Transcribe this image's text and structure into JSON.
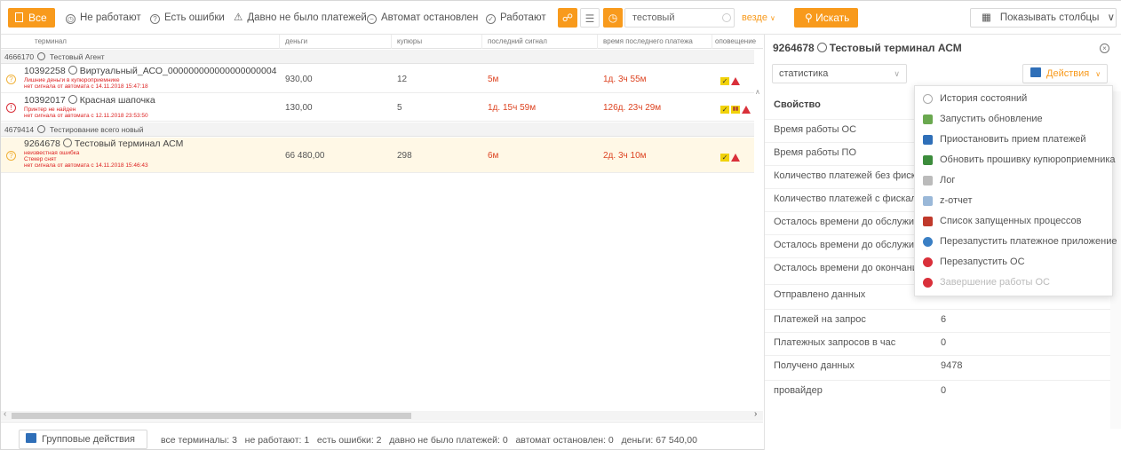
{
  "toolbar": {
    "filter_all": "Все",
    "filter_not_working": "Не работают",
    "filter_errors": "Есть ошибки",
    "filter_no_payments": "Давно не было платежей",
    "filter_stopped": "Автомат остановлен",
    "filter_working": "Работают",
    "search_value": "тестовый",
    "scope": "везде",
    "search_button": "Искать",
    "columns_button": "Показывать столбцы",
    "accent": "#f89a1c"
  },
  "table": {
    "headers": [
      "терминал",
      "деньги",
      "купюры",
      "последний сигнал",
      "время последнего платежа",
      "оповещение"
    ],
    "groups": [
      {
        "label": "4666170",
        "name": "Тестовый Агент"
      },
      {
        "label": "4679414",
        "name": "Тестирование всего новый"
      }
    ],
    "rows": [
      {
        "id": "10392258",
        "name": "Виртуальный_АСО_000000000000000000004",
        "errors": [
          "Лишние деньги в купюроприемнике",
          "нет сигнала от автомата с 14.11.2018 15:47:18"
        ],
        "money": "930,00",
        "bills": "12",
        "last_signal": "5м",
        "last_payment": "1д. 3ч 55м",
        "status": "warn"
      },
      {
        "id": "10392017",
        "name": "Красная шапочка",
        "errors": [
          "Принтер не найден",
          "нет сигнала от автомата с 12.11.2018 23:53:50"
        ],
        "money": "130,00",
        "bills": "5",
        "last_signal": "1д. 15ч 59м",
        "last_payment": "126д. 23ч 29м",
        "status": "err"
      },
      {
        "id": "9264678",
        "name": "Тестовый терминал АСМ",
        "errors": [
          "неизвестная ошибка",
          "Стекер снят",
          "нет сигнала от автомата с 14.11.2018 15:46:43"
        ],
        "money": "66 480,00",
        "bills": "298",
        "last_signal": "6м",
        "last_payment": "2д. 3ч 10м",
        "status": "warn"
      }
    ]
  },
  "footer": {
    "group_actions": "Групповые действия",
    "summary": "все терминалы: 3   не работают: 1   есть ошибки: 2   давно не было платежей: 0   автомат остановлен: 0   деньги: 67 540,00"
  },
  "panel": {
    "title_id": "9264678",
    "title_name": "Тестовый терминал АСМ",
    "view_select": "статистика",
    "actions_button": "Действия",
    "header_key": "Свойство",
    "rows": [
      {
        "k": "Время работы ОС",
        "v": ""
      },
      {
        "k": "Время работы ПО",
        "v": ""
      },
      {
        "k": "Количество платежей без фискал",
        "v": ""
      },
      {
        "k": "Количество платежей с фискальн",
        "v": ""
      },
      {
        "k": "Осталось времени до обслужива",
        "v": ""
      },
      {
        "k": "Осталось времени до обслужива",
        "v": ""
      },
      {
        "k": "Осталось времени до окончания",
        "v": ""
      },
      {
        "k": "Отправлено данных",
        "v": ""
      },
      {
        "k": "Платежей на запрос",
        "v": "6"
      },
      {
        "k": "Платежных запросов в час",
        "v": "0"
      },
      {
        "k": "Получено данных",
        "v": "9478"
      },
      {
        "k": "провайдер",
        "v": "0"
      }
    ]
  },
  "actions_menu": [
    {
      "label": "История состояний",
      "icon": "history-icon",
      "color": "#aaaaaa",
      "disabled": false
    },
    {
      "label": "Запустить обновление",
      "icon": "update-icon",
      "color": "#6aa84f",
      "disabled": false
    },
    {
      "label": "Приостановить прием платежей",
      "icon": "pause-payments-icon",
      "color": "#2f6fb8",
      "disabled": false
    },
    {
      "label": "Обновить прошивку купюроприемника",
      "icon": "firmware-icon",
      "color": "#3c8c3c",
      "disabled": false
    },
    {
      "label": "Лог",
      "icon": "log-icon",
      "color": "#bbbbbb",
      "disabled": false
    },
    {
      "label": "z-отчет",
      "icon": "report-icon",
      "color": "#9ab8d8",
      "disabled": false
    },
    {
      "label": "Список запущенных процессов",
      "icon": "process-list-icon",
      "color": "#c0392b",
      "disabled": false
    },
    {
      "label": "Перезапустить платежное приложение",
      "icon": "restart-app-icon",
      "color": "#3a7fc4",
      "disabled": false
    },
    {
      "label": "Перезапустить ОС",
      "icon": "restart-os-icon",
      "color": "#d9303a",
      "disabled": false
    },
    {
      "label": "Завершение работы ОС",
      "icon": "shutdown-icon",
      "color": "#d9303a",
      "disabled": true
    }
  ]
}
